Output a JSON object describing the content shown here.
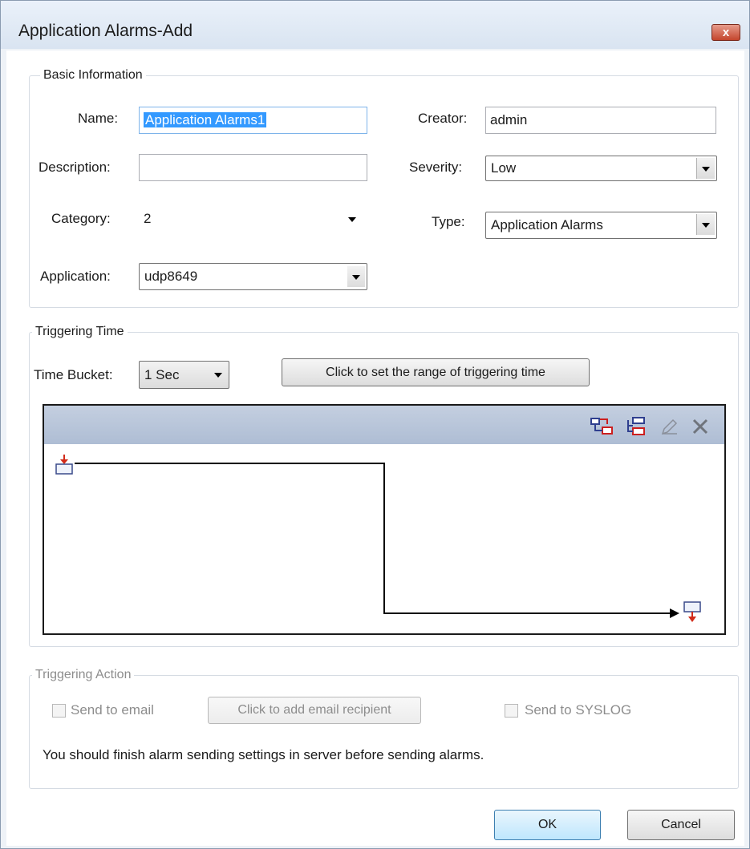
{
  "window": {
    "title": "Application Alarms-Add",
    "close_glyph": "x"
  },
  "basic": {
    "legend": "Basic Information",
    "name_label": "Name:",
    "name_value": "Application Alarms1",
    "creator_label": "Creator:",
    "creator_value": "admin",
    "description_label": "Description:",
    "description_value": "",
    "severity_label": "Severity:",
    "severity_value": "Low",
    "category_label": "Category:",
    "category_value": "2",
    "type_label": "Type:",
    "type_value": "Application Alarms",
    "application_label": "Application:",
    "application_value": "udp8649"
  },
  "trigger_time": {
    "legend": "Triggering Time",
    "bucket_label": "Time Bucket:",
    "bucket_value": "1 Sec",
    "range_button": "Click to set the range of triggering time",
    "toolbar_icons": [
      "add-node-icon",
      "insert-node-icon",
      "edit-icon",
      "delete-icon"
    ],
    "flow_icons": [
      "start-node-icon",
      "end-node-icon"
    ]
  },
  "trigger_action": {
    "legend": "Triggering Action",
    "email_label": "Send to email",
    "email_button": "Click to add email recipient",
    "syslog_label": "Send to SYSLOG",
    "note": "You should finish alarm sending settings in server before sending alarms."
  },
  "footer": {
    "ok": "OK",
    "cancel": "Cancel"
  },
  "colors": {
    "selection": "#3399ff",
    "titlebar": "#dce6f2",
    "close_button": "#c4452d",
    "flow_header": "#b4c2d8",
    "start_arrow": "#d22b1a",
    "node_outline": "#3a4a8a"
  }
}
